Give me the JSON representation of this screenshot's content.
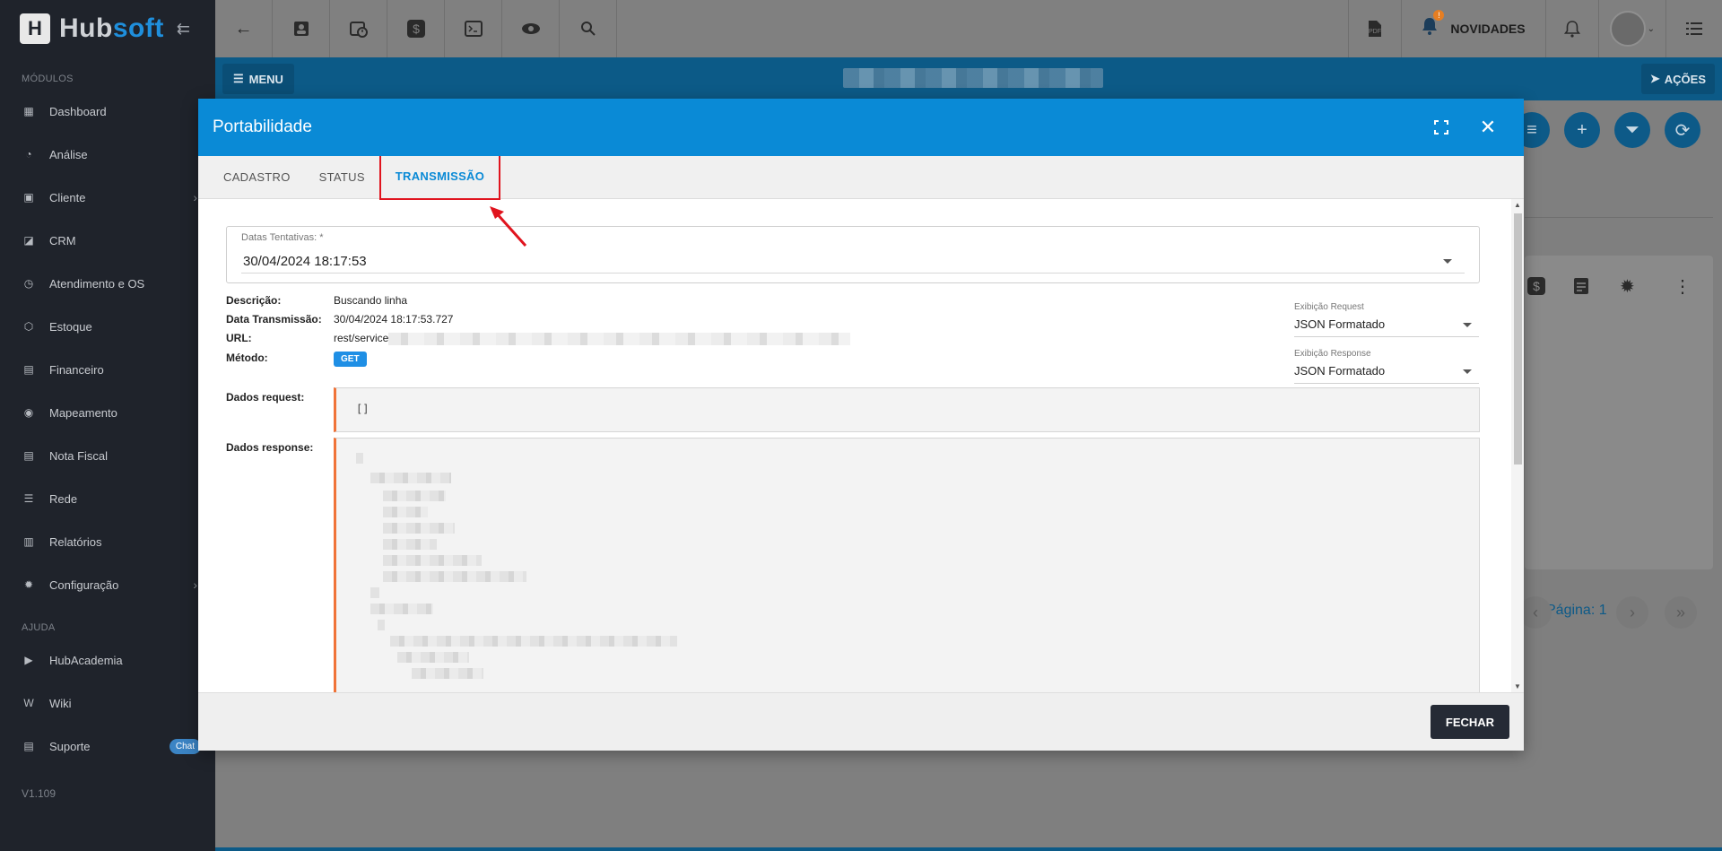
{
  "app": {
    "logo_text_a": "Hub",
    "logo_text_b": "soft",
    "logo_mark": "H"
  },
  "sidebar": {
    "section_modules": "MÓDULOS",
    "items": [
      {
        "label": "Dashboard",
        "icon": "dashboard-icon",
        "glyph": "▦"
      },
      {
        "label": "Análise",
        "icon": "pie-chart-icon",
        "glyph": "◔"
      },
      {
        "label": "Cliente",
        "icon": "client-card-icon",
        "glyph": "▣",
        "chevron": "›"
      },
      {
        "label": "CRM",
        "icon": "crm-icon",
        "glyph": "◪"
      },
      {
        "label": "Atendimento e OS",
        "icon": "calendar-clock-icon",
        "glyph": "◷"
      },
      {
        "label": "Estoque",
        "icon": "box-icon",
        "glyph": "⬡"
      },
      {
        "label": "Financeiro",
        "icon": "money-icon",
        "glyph": "▤"
      },
      {
        "label": "Mapeamento",
        "icon": "map-pin-icon",
        "glyph": "◉"
      },
      {
        "label": "Nota Fiscal",
        "icon": "invoice-icon",
        "glyph": "▤"
      },
      {
        "label": "Rede",
        "icon": "server-icon",
        "glyph": "☰"
      },
      {
        "label": "Relatórios",
        "icon": "report-icon",
        "glyph": "▥"
      },
      {
        "label": "Configuração",
        "icon": "gear-icon",
        "glyph": "✹",
        "chevron": "›"
      }
    ],
    "section_help": "AJUDA",
    "help_items": [
      {
        "label": "HubAcademia",
        "icon": "youtube-icon",
        "glyph": "▶"
      },
      {
        "label": "Wiki",
        "icon": "wiki-icon",
        "glyph": "W"
      },
      {
        "label": "Suporte",
        "icon": "support-icon",
        "glyph": "▤",
        "badge": "Chat"
      }
    ],
    "version": "V1.109"
  },
  "topbar": {
    "novidades": "NOVIDADES"
  },
  "bluebar": {
    "menu_label": "MENU",
    "acoes_label": "AÇÕES"
  },
  "background": {
    "pagina": "Página: 1"
  },
  "modal": {
    "title": "Portabilidade",
    "tabs": [
      {
        "label": "CADASTRO"
      },
      {
        "label": "STATUS"
      },
      {
        "label": "TRANSMISSÃO",
        "active": true
      }
    ],
    "datas_label": "Datas Tentativas: *",
    "datas_value": "30/04/2024 18:17:53",
    "info": {
      "descricao_label": "Descrição:",
      "descricao_value": "Buscando linha",
      "data_label": "Data Transmissão:",
      "data_value": "30/04/2024 18:17:53.727",
      "url_label": "URL:",
      "url_value": "rest/service",
      "metodo_label": "Método:",
      "metodo_value": "GET"
    },
    "exib_request_label": "Exibição Request",
    "exib_request_value": "JSON Formatado",
    "exib_response_label": "Exibição Response",
    "exib_response_value": "JSON Formatado",
    "dados_request_label": "Dados request:",
    "dados_request_value": "[]",
    "dados_response_label": "Dados response:",
    "fechar_label": "FECHAR"
  },
  "colors": {
    "modal_header": "#0a8ad6",
    "tab_active": "#0a8ad6",
    "highlight_red": "#e0141e",
    "code_accent": "#f07338",
    "sidebar_bg": "#1f232b"
  }
}
